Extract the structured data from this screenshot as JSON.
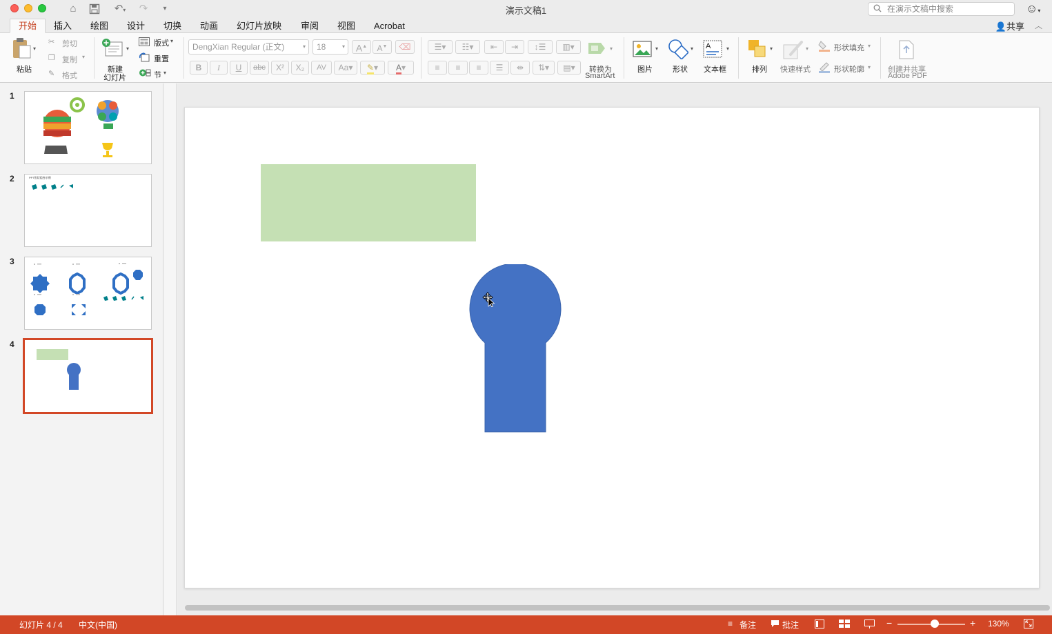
{
  "window": {
    "title": "演示文稿1",
    "search_placeholder": "在演示文稿中搜索"
  },
  "tabs": [
    {
      "label": "开始",
      "active": true
    },
    {
      "label": "插入"
    },
    {
      "label": "绘图"
    },
    {
      "label": "设计"
    },
    {
      "label": "切换"
    },
    {
      "label": "动画"
    },
    {
      "label": "幻灯片放映"
    },
    {
      "label": "审阅"
    },
    {
      "label": "视图"
    },
    {
      "label": "Acrobat"
    }
  ],
  "share_label": "共享",
  "ribbon": {
    "paste": "粘贴",
    "cut": "剪切",
    "copy": "复制",
    "format": "格式",
    "new_slide_1": "新建",
    "new_slide_2": "幻灯片",
    "layout": "版式",
    "reset": "重置",
    "section": "节",
    "font_name": "DengXian Regular (正文)",
    "font_size": "18",
    "convert_1": "转换为",
    "convert_2": "SmartArt",
    "picture": "图片",
    "shape": "形状",
    "textbox": "文本框",
    "arrange": "排列",
    "quick_styles": "快速样式",
    "shape_fill": "形状填充",
    "shape_outline": "形状轮廓",
    "adobe_1": "创建并共享",
    "adobe_2": "Adobe PDF",
    "format_buttons": {
      "bold": "B",
      "italic": "I",
      "underline": "U",
      "strike": "abc",
      "superscript": "X²",
      "subscript": "X₂",
      "spacing": "AV",
      "grow": "A",
      "shrink": "A"
    }
  },
  "slides": [
    {
      "number": "1"
    },
    {
      "number": "2",
      "thumb_title": "PPT形状组合示例"
    },
    {
      "number": "3"
    },
    {
      "number": "4",
      "selected": true
    }
  ],
  "status": {
    "slide_counter": "幻灯片 4 / 4",
    "language": "中文(中国)",
    "notes": "备注",
    "comments": "批注",
    "zoom_level": "130%",
    "zoom_slider_fraction": 0.55
  },
  "colors": {
    "accent": "#d24726",
    "shape_blue": "#4472c4",
    "rect_green": "#c5e0b4"
  }
}
